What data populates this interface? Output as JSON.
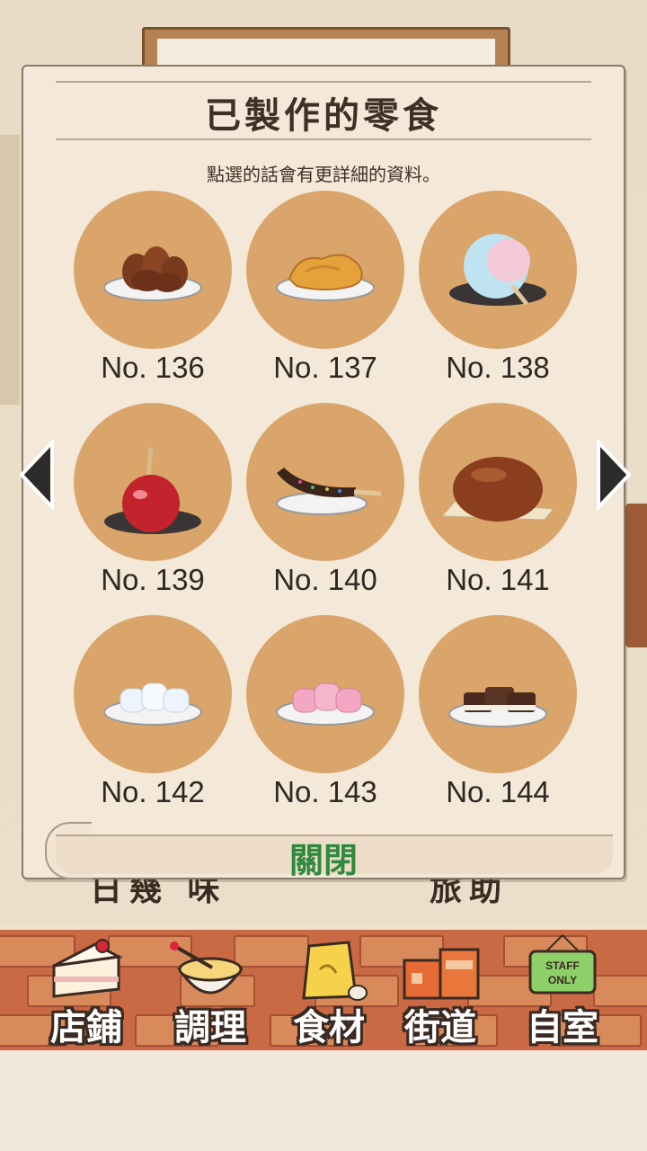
{
  "dialog": {
    "title": "已製作的零食",
    "subtitle": "點選的話會有更詳細的資料。",
    "close_label": "關閉"
  },
  "items": [
    {
      "number": "No. 136",
      "food": "karinto-dark-twists"
    },
    {
      "number": "No. 137",
      "food": "golden-fried-snack"
    },
    {
      "number": "No. 138",
      "food": "cotton-candy"
    },
    {
      "number": "No. 139",
      "food": "candy-apple"
    },
    {
      "number": "No. 140",
      "food": "chocolate-banana"
    },
    {
      "number": "No. 141",
      "food": "anpan-bun"
    },
    {
      "number": "No. 142",
      "food": "white-marshmallows"
    },
    {
      "number": "No. 143",
      "food": "pink-marshmallows"
    },
    {
      "number": "No. 144",
      "food": "chocolate-cakes"
    }
  ],
  "nav": [
    {
      "label": "店鋪",
      "icon": "cake-slice-icon"
    },
    {
      "label": "調理",
      "icon": "mixing-bowl-icon"
    },
    {
      "label": "食材",
      "icon": "flour-bag-icon"
    },
    {
      "label": "街道",
      "icon": "shop-building-icon"
    },
    {
      "label": "自室",
      "icon": "staff-only-sign-icon",
      "sign_text": "STAFF ONLY"
    }
  ],
  "background": {
    "text_left": "日幾 味",
    "text_right": "旅助"
  },
  "colors": {
    "circle": "#d9a56b",
    "close_green": "#2f8a3e",
    "brick": "#c96a45"
  }
}
